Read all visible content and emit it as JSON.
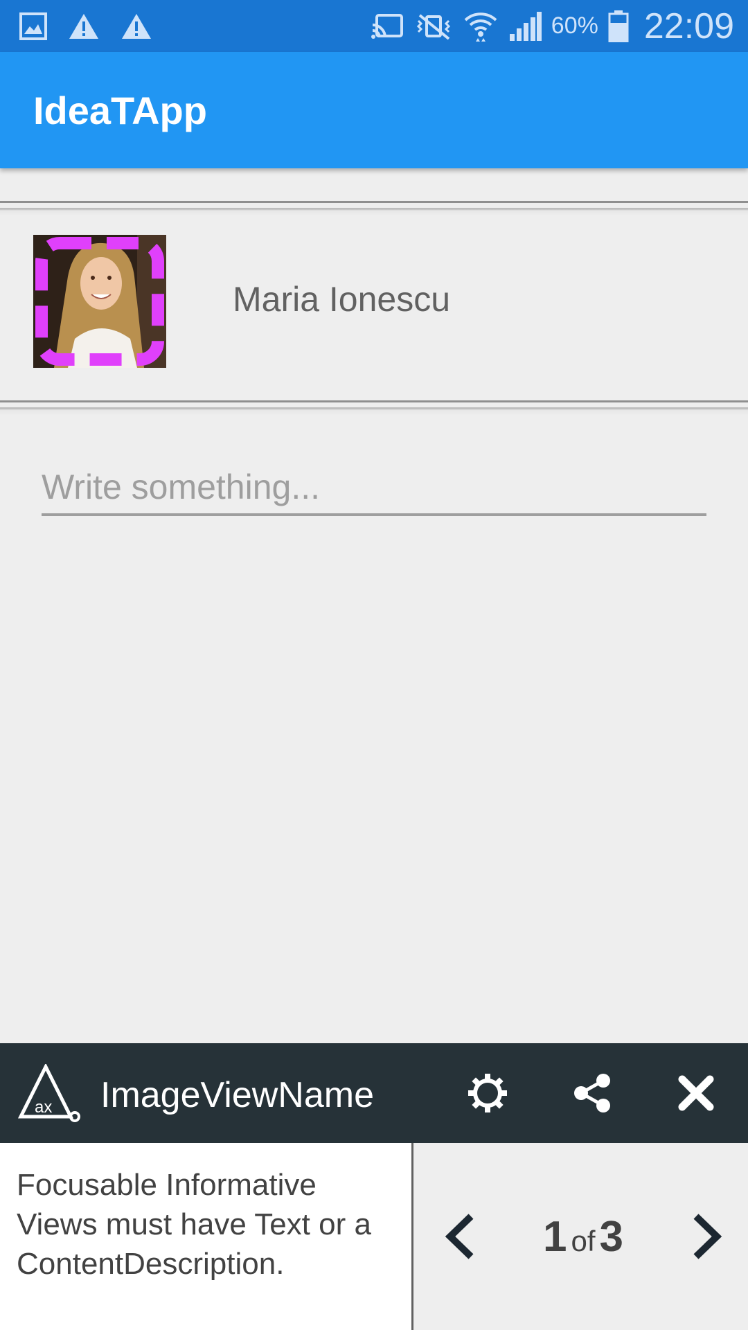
{
  "status_bar": {
    "left_icons": [
      "gallery-icon",
      "warning-icon",
      "warning-icon"
    ],
    "right_icons": [
      "cast-icon",
      "vibrate-mute-icon",
      "wifi-icon",
      "signal-icon",
      "battery-icon"
    ],
    "battery_percent": "60%",
    "time": "22:09"
  },
  "app_bar": {
    "title": "IdeaTApp"
  },
  "profile": {
    "name": "Maria Ionescu",
    "avatar_highlight_color": "#e040fb"
  },
  "composer": {
    "placeholder": "Write something..."
  },
  "accessibility_panel": {
    "title": "ImageViewName",
    "icons": [
      "ax-logo-icon",
      "settings-icon",
      "share-icon",
      "close-icon"
    ],
    "message": "Focusable Informative Views must have Text or a ContentDescription.",
    "counter": {
      "current": "1",
      "of_label": "of",
      "total": "3"
    },
    "header_color": "#263238"
  },
  "colors": {
    "status_bar": "#1976d2",
    "app_bar": "#2196f3",
    "background": "#eeeeee"
  }
}
